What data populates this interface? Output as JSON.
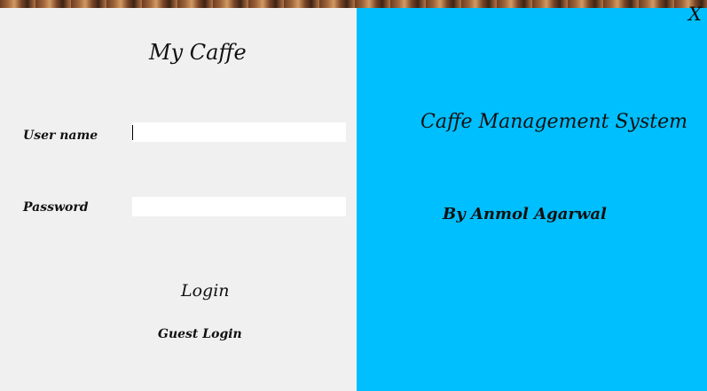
{
  "window": {
    "close_label": "X"
  },
  "login_panel": {
    "title": "My Caffe",
    "username_label": "User name",
    "username_value": "",
    "password_label": "Password",
    "password_value": "",
    "login_label": "Login",
    "guest_login_label": "Guest Login"
  },
  "info_panel": {
    "title": "Caffe Management System",
    "author": "By Anmol Agarwal"
  },
  "colors": {
    "left_panel_bg": "#f0f0f0",
    "right_panel_bg": "#00bfff"
  }
}
